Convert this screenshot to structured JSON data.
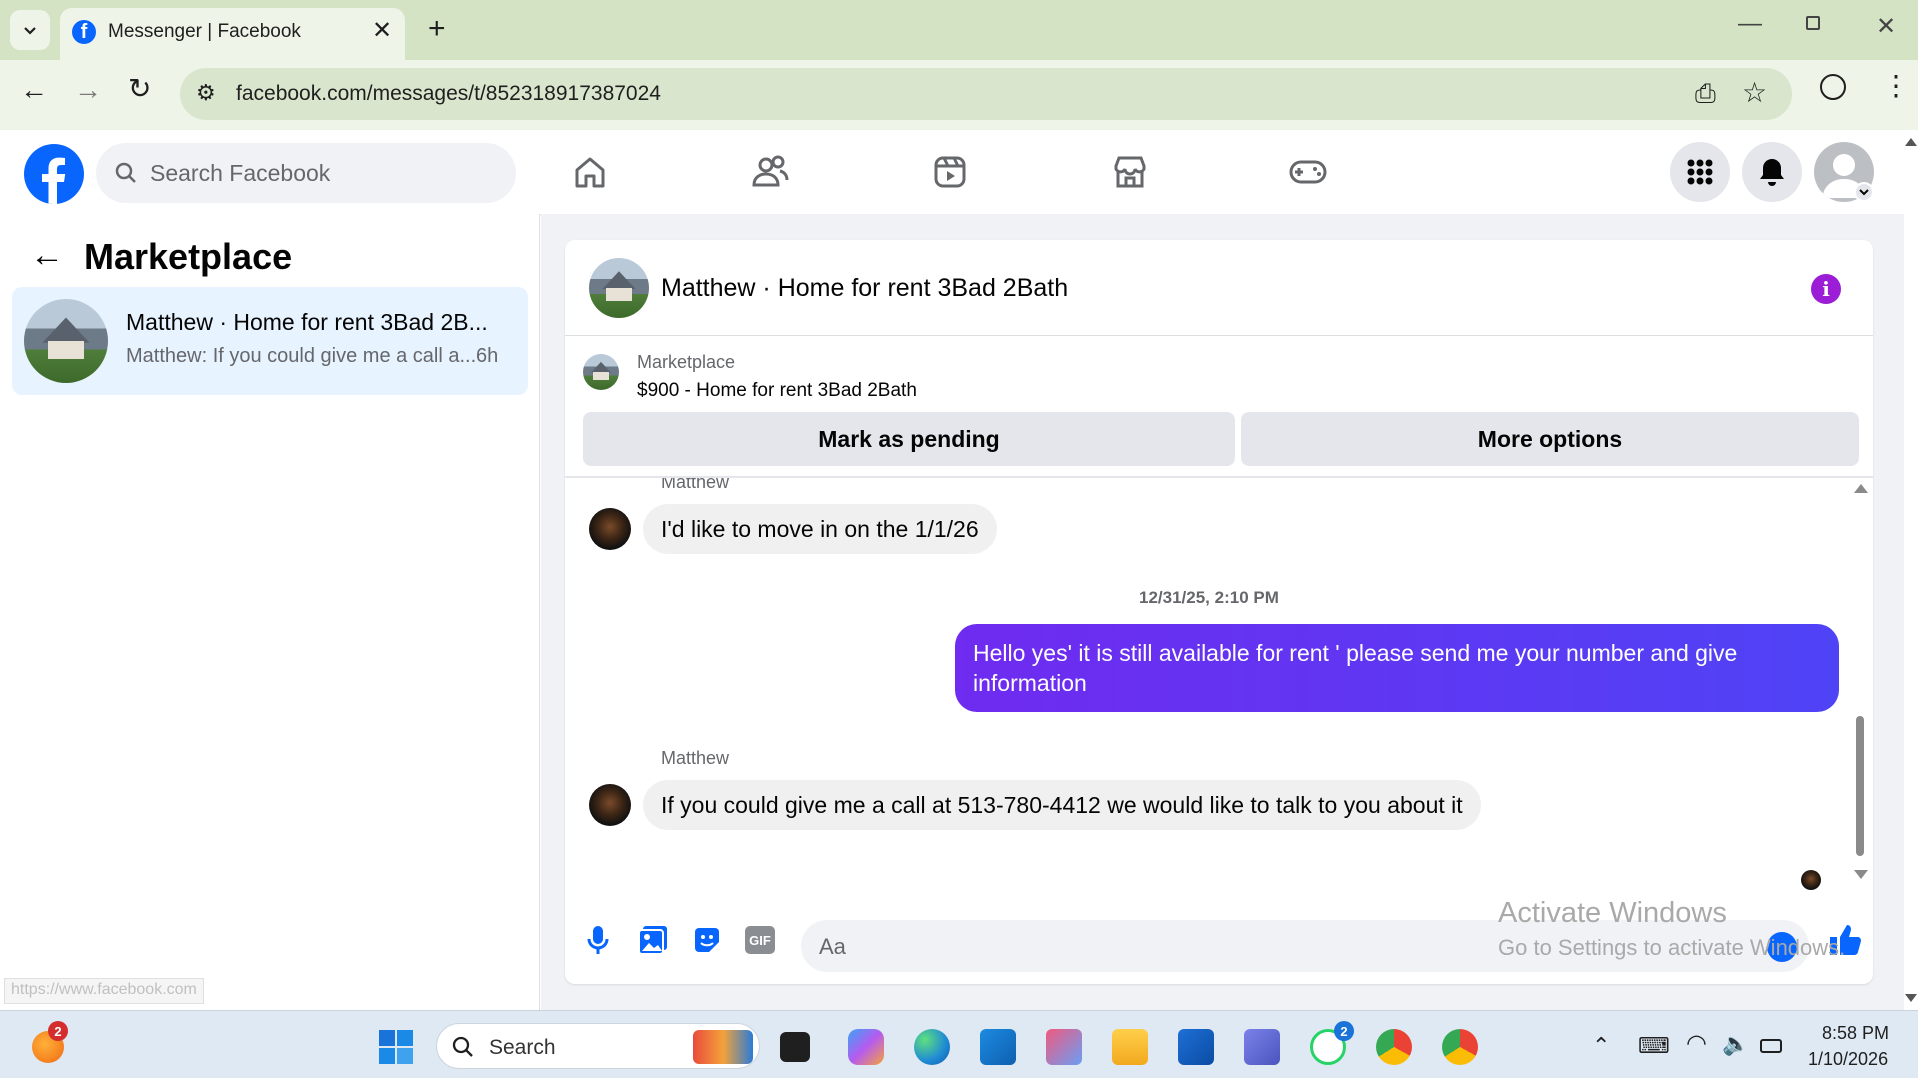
{
  "browser": {
    "tab_title": "Messenger | Facebook",
    "url": "facebook.com/messages/t/852318917387024",
    "status_url": "https://www.facebook.com"
  },
  "fb": {
    "search_placeholder": "Search Facebook"
  },
  "left": {
    "title": "Marketplace",
    "thread": {
      "name": "Matthew · Home for rent 3Bad 2B...",
      "preview": "Matthew: If you could give me a call a...",
      "time": "6h"
    }
  },
  "chat": {
    "header_title": "Matthew · Home for rent 3Bad 2Bath",
    "listing": {
      "source": "Marketplace",
      "title": "$900 - Home for rent 3Bad 2Bath"
    },
    "buttons": {
      "pending": "Mark as pending",
      "more": "More options"
    },
    "messages": {
      "sender1": "Matthew",
      "msg1": "I'd like to move in on the 1/1/26",
      "timestamp": "12/31/25, 2:10 PM",
      "msg2": "Hello yes' it is still available for rent ' please send me your number and give information",
      "sender2": "Matthew",
      "msg3": "If you could give me a call at 513-780-4412 we would like to talk to you about it"
    },
    "composer_placeholder": "Aa"
  },
  "watermark": {
    "line1": "Activate Windows",
    "line2": "Go to Settings to activate Windows."
  },
  "taskbar": {
    "search_label": "Search",
    "time": "8:58 PM",
    "date": "1/10/2026",
    "badge_weather": "2",
    "badge_whatsapp": "2"
  },
  "colors": {
    "fb_blue": "#0866ff",
    "outgoing_bubble": "#5b3af4",
    "info_icon": "#9b1ed6"
  }
}
